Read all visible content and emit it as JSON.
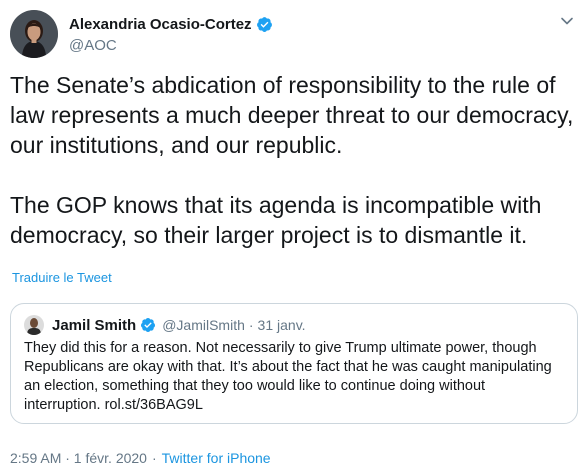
{
  "tweet": {
    "author": {
      "name": "Alexandria Ocasio-Cortez",
      "handle": "@AOC"
    },
    "paragraphs": [
      "The Senate’s abdication of responsibility to the rule of law represents a much deeper threat to our democracy, our institutions, and our republic.",
      "The GOP knows that its agenda is incompatible with democracy, so their larger project is to dismantle it."
    ],
    "translate_label": "Traduire le Tweet",
    "quoted": {
      "name": "Jamil Smith",
      "handle": "@JamilSmith",
      "separator": "·",
      "date": "31 janv.",
      "text": "They did this for a reason. Not necessarily to give Trump ultimate power, though Republicans are okay with that. It’s about the fact that he was caught manipulating an election, something that they too would like to continue doing without interruption. rol.st/36BAG9L"
    },
    "timestamp": "2:59 AM · 1 févr. 2020",
    "dot": "·",
    "source": "Twitter for iPhone"
  },
  "colors": {
    "link_blue": "#1b95e0",
    "verified_blue": "#1da1f2",
    "muted_gray": "#657786",
    "border": "#ccd6dd"
  },
  "icons": {
    "verified": "verified-badge-icon",
    "chevron": "chevron-down-icon"
  }
}
